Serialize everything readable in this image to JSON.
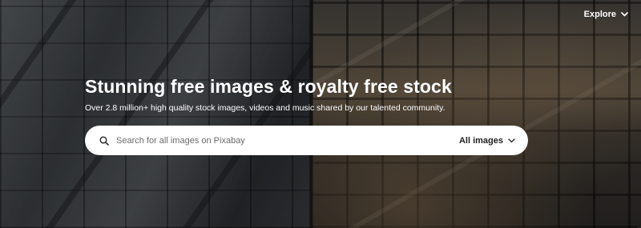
{
  "nav": {
    "explore_label": "Explore",
    "explore_icon": "chevron-down-icon"
  },
  "hero": {
    "title": "Stunning free images & royalty free stock",
    "subtitle": "Over 2.8 million+ high quality stock images, videos and music shared by our talented community."
  },
  "search": {
    "icon": "search-icon",
    "placeholder": "Search for all images on Pixabay",
    "value": "",
    "type_selected": "All images",
    "type_icon": "chevron-down-icon"
  },
  "colors": {
    "text_on_dark": "#ffffff",
    "search_bg": "#ffffff",
    "search_text": "#222222"
  }
}
